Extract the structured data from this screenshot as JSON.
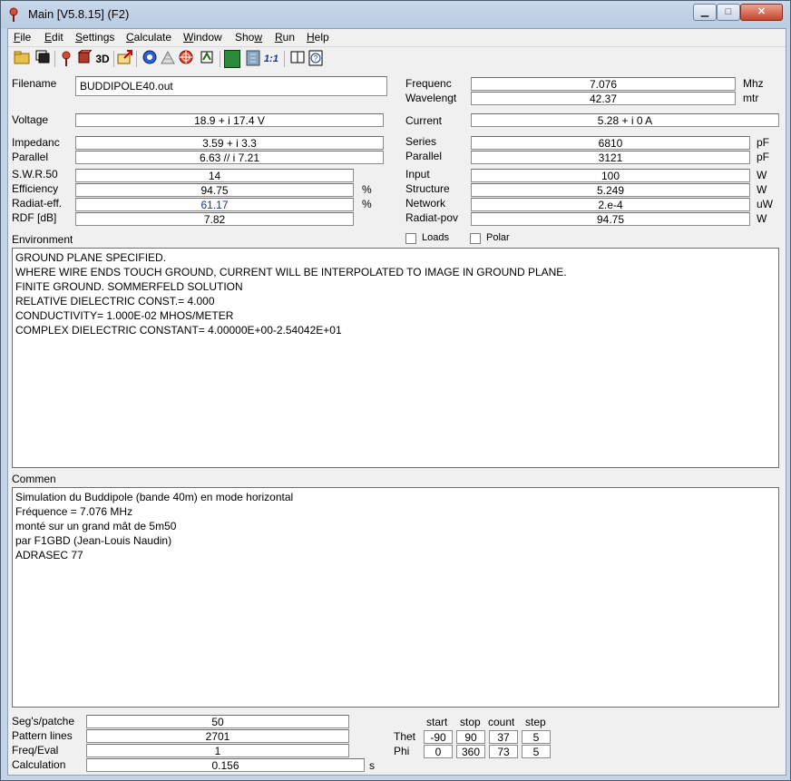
{
  "window": {
    "title": "Main [V5.8.15]  (F2)",
    "minimize": "▁",
    "maximize": "□",
    "close": "✕"
  },
  "menu": [
    "File",
    "Edit",
    "Settings",
    "Calculate",
    "Window",
    "Show",
    "Run",
    "Help"
  ],
  "menu_accel": [
    "F",
    "E",
    "S",
    "C",
    "W",
    "w",
    "R",
    "H"
  ],
  "toolbar_icons": [
    "open-folder-icon",
    "copy-window-icon",
    "antenna-icon",
    "geometry-icon",
    "3d-icon",
    "export-icon",
    "farfield-icon",
    "nearfield-icon",
    "pattern-icon",
    "optimize-icon",
    "calculator-icon",
    "tuning-icon",
    "scale-icon",
    "book-icon",
    "help-icon"
  ],
  "toolbar_text": {
    "three_d": "3D",
    "ratio": "1:1"
  },
  "filename": {
    "label": "Filename",
    "value": "BUDDIPOLE40.out"
  },
  "frequency": {
    "label": "Frequenc",
    "value": "7.076",
    "unit": "Mhz"
  },
  "wavelength": {
    "label": "Wavelengt",
    "value": "42.37",
    "unit": "mtr"
  },
  "voltage": {
    "label": "Voltage",
    "value": "18.9 + i 17.4 V"
  },
  "current": {
    "label": "Current",
    "value": "5.28 + i 0 A"
  },
  "impedance": {
    "label": "Impedanc",
    "value": "3.59 + i 3.3"
  },
  "parallel_z": {
    "label": "Parallel",
    "value": "6.63 // i 7.21"
  },
  "series": {
    "label": "Series",
    "value": "6810",
    "unit": "pF"
  },
  "parallel_c": {
    "label": "Parallel",
    "value": "3121",
    "unit": "pF"
  },
  "swr": {
    "label": "S.W.R.50",
    "value": "14"
  },
  "efficiency": {
    "label": "Efficiency",
    "value": "94.75",
    "unit": "%"
  },
  "radiat_eff": {
    "label": "Radiat-eff.",
    "value": "61.17",
    "unit": "%"
  },
  "rdf": {
    "label": "RDF [dB]",
    "value": "7.82"
  },
  "input": {
    "label": "Input",
    "value": "100",
    "unit": "W"
  },
  "structure": {
    "label": "Structure",
    "value": "5.249",
    "unit": "W"
  },
  "network": {
    "label": "Network",
    "value": "2.e-4",
    "unit": "uW"
  },
  "radiat_pow": {
    "label": "Radiat-pov",
    "value": "94.75",
    "unit": "W"
  },
  "environment": {
    "label": "Environment",
    "loads_label": "Loads",
    "polar_label": "Polar",
    "lines": [
      "GROUND PLANE SPECIFIED.",
      "WHERE WIRE ENDS TOUCH GROUND, CURRENT WILL BE INTERPOLATED TO IMAGE IN GROUND PLANE.",
      "FINITE GROUND.  SOMMERFELD SOLUTION",
      "RELATIVE DIELECTRIC CONST.=  4.000",
      "CONDUCTIVITY= 1.000E-02 MHOS/METER",
      "COMPLEX DIELECTRIC CONSTANT= 4.00000E+00-2.54042E+01"
    ]
  },
  "comment": {
    "label": "Commen",
    "lines": [
      "Simulation du Buddipole (bande 40m) en mode horizontal",
      "Fréquence = 7.076 MHz",
      "monté sur un grand mât de 5m50",
      "par F1GBD (Jean-Louis Naudin)",
      "ADRASEC 77"
    ]
  },
  "segs": {
    "label": "Seg's/patche",
    "value": "50"
  },
  "pattern_lines": {
    "label": "Pattern lines",
    "value": "2701"
  },
  "freq_eval": {
    "label": "Freq/Eval",
    "value": "1"
  },
  "calculation": {
    "label": "Calculation",
    "value": "0.156",
    "unit": "s"
  },
  "sweep": {
    "headers": {
      "start": "start",
      "stop": "stop",
      "count": "count",
      "step": "step"
    },
    "theta": {
      "label": "Thet",
      "start": "-90",
      "stop": "90",
      "count": "37",
      "step": "5"
    },
    "phi": {
      "label": "Phi",
      "start": "0",
      "stop": "360",
      "count": "73",
      "step": "5"
    }
  }
}
